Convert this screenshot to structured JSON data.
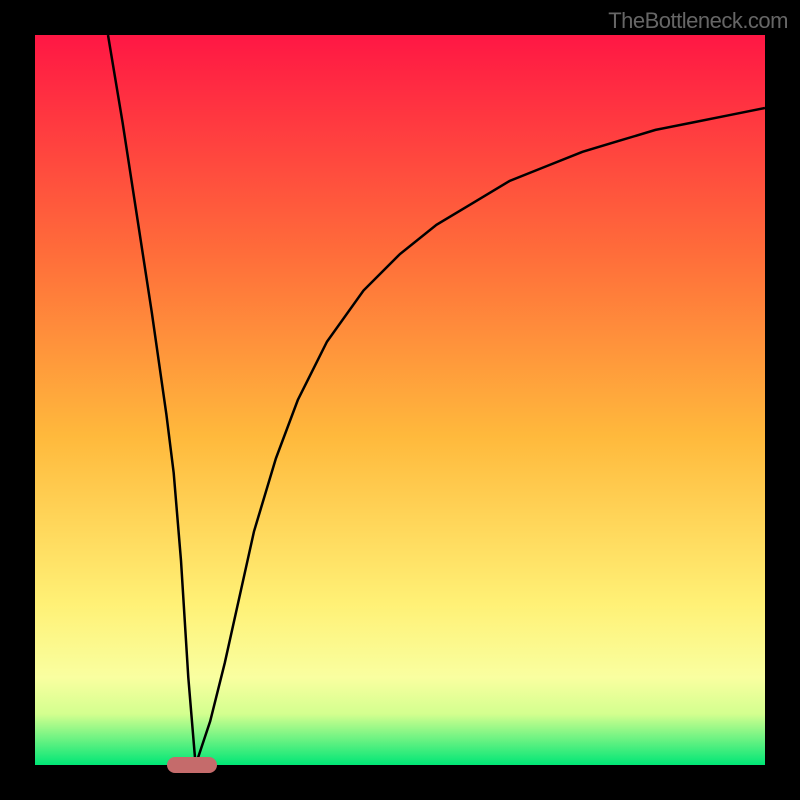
{
  "watermark": "TheBottleneck.com",
  "colors": {
    "top": "#ff1744",
    "upper_mid": "#ff6d3a",
    "mid": "#ffb93c",
    "lower_mid": "#fff176",
    "lower": "#f9ffa0",
    "bottom_band": "#d4ff8f",
    "bottom": "#00e676",
    "line": "#000000",
    "background": "#000000",
    "marker": "#c56b6b"
  },
  "chart_data": {
    "type": "line",
    "title": "",
    "xlabel": "",
    "ylabel": "",
    "xlim": [
      0,
      100
    ],
    "ylim": [
      0,
      100
    ],
    "series": [
      {
        "name": "curve",
        "x": [
          10,
          12,
          14,
          16,
          18,
          19,
          20,
          21,
          22,
          24,
          26,
          28,
          30,
          33,
          36,
          40,
          45,
          50,
          55,
          60,
          65,
          70,
          75,
          80,
          85,
          90,
          95,
          100
        ],
        "values": [
          100,
          88,
          75,
          62,
          48,
          40,
          28,
          12,
          0,
          6,
          14,
          23,
          32,
          42,
          50,
          58,
          65,
          70,
          74,
          77,
          80,
          82,
          84,
          85.5,
          87,
          88,
          89,
          90
        ]
      }
    ],
    "marker": {
      "x": 21.5,
      "y": 0
    },
    "gradient_bands": [
      {
        "pos": 0.0,
        "color": "#ff1744"
      },
      {
        "pos": 0.3,
        "color": "#ff6d3a"
      },
      {
        "pos": 0.55,
        "color": "#ffb93c"
      },
      {
        "pos": 0.78,
        "color": "#fff176"
      },
      {
        "pos": 0.88,
        "color": "#f9ffa0"
      },
      {
        "pos": 0.93,
        "color": "#d4ff8f"
      },
      {
        "pos": 1.0,
        "color": "#00e676"
      }
    ]
  }
}
